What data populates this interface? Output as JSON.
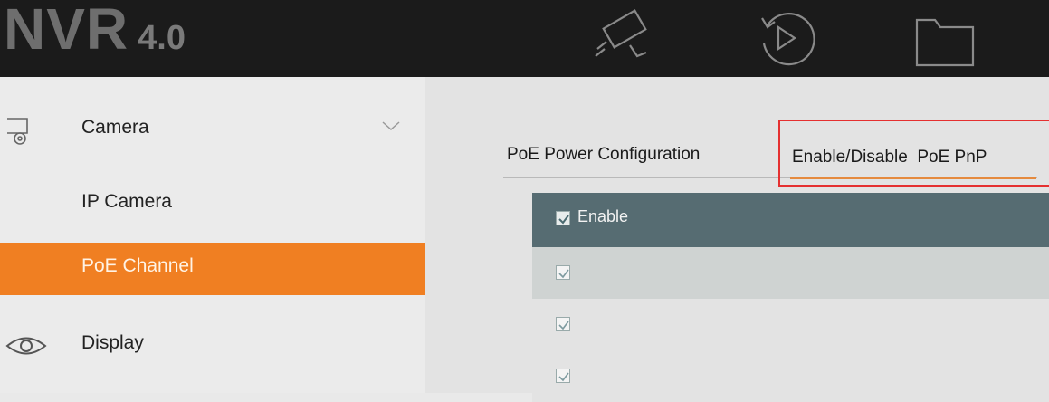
{
  "header": {
    "brand": "NVR",
    "version": "4.0",
    "nav_icons": [
      "camera-icon",
      "playback-icon",
      "folder-icon"
    ]
  },
  "sidebar": {
    "items": [
      {
        "label": "Camera",
        "icon": "camera-settings-icon",
        "expandable": true
      },
      {
        "label": "IP Camera"
      },
      {
        "label": "PoE Channel",
        "active": true
      },
      {
        "label": "Display",
        "icon": "eye-icon"
      }
    ]
  },
  "main": {
    "tabs": [
      {
        "label": "PoE Power Configuration",
        "active": false
      },
      {
        "label": "Enable/Disable  PoE PnP",
        "active": true
      }
    ],
    "table": {
      "header": {
        "label": "Enable",
        "checked": true
      },
      "rows": [
        {
          "checked": true
        },
        {
          "checked": true
        },
        {
          "checked": true
        }
      ]
    }
  },
  "colors": {
    "topbar": "#1b1b1b",
    "accent": "#f07f22",
    "table_header": "#566c72",
    "highlight": "#e53030"
  }
}
